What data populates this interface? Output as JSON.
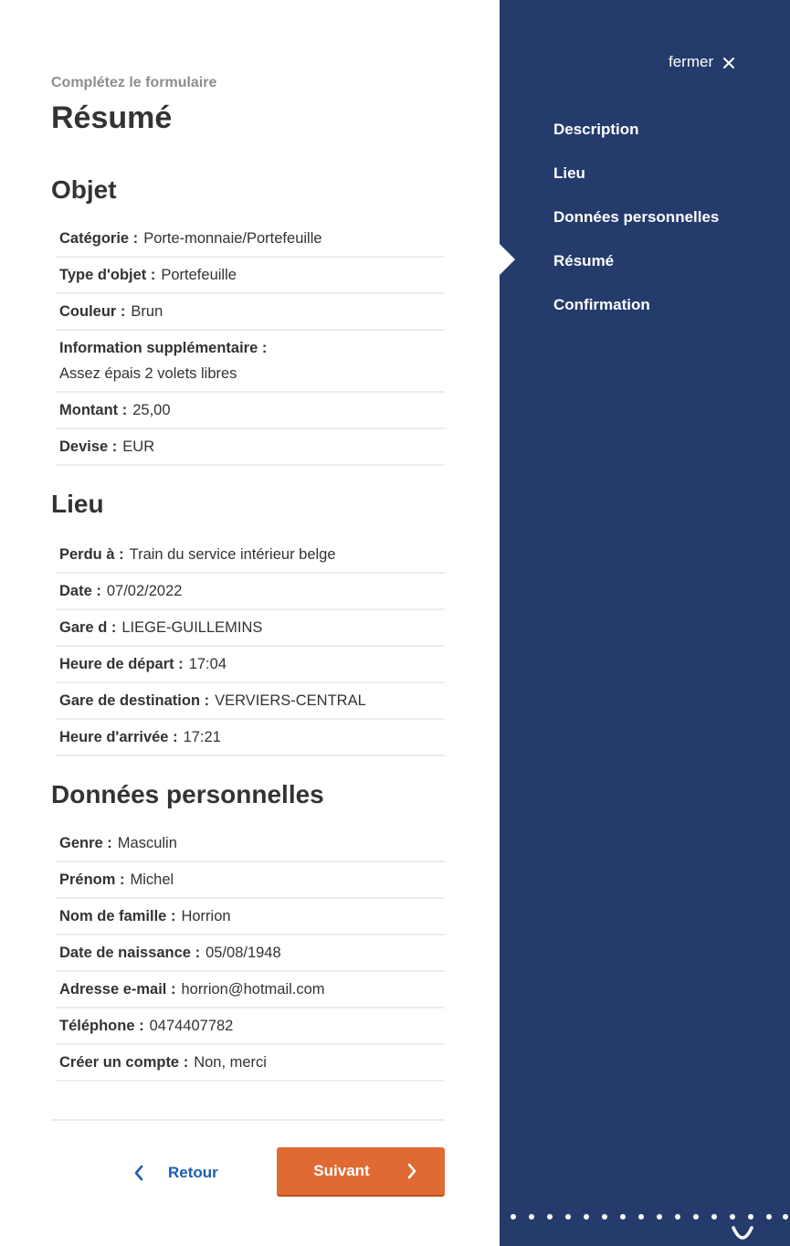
{
  "header": {
    "subtitle": "Complétez le formulaire",
    "title": "Résumé"
  },
  "sections": {
    "objet": {
      "title": "Objet",
      "rows": [
        {
          "label": "Catégorie :",
          "value": "Porte-monnaie/Portefeuille"
        },
        {
          "label": "Type d'objet :",
          "value": "Portefeuille"
        },
        {
          "label": "Couleur :",
          "value": "Brun"
        },
        {
          "label": "Information supplémentaire :",
          "value": "Assez épais 2 volets libres"
        },
        {
          "label": "Montant :",
          "value": "25,00"
        },
        {
          "label": "Devise :",
          "value": "EUR"
        }
      ]
    },
    "lieu": {
      "title": "Lieu",
      "rows": [
        {
          "label": "Perdu à :",
          "value": "Train du service intérieur belge"
        },
        {
          "label": "Date :",
          "value": "07/02/2022"
        },
        {
          "label": "Gare d :",
          "value": "LIEGE-GUILLEMINS"
        },
        {
          "label": "Heure de départ :",
          "value": "17:04"
        },
        {
          "label": "Gare de destination :",
          "value": "VERVIERS-CENTRAL"
        },
        {
          "label": "Heure d'arrivée :",
          "value": "17:21"
        }
      ]
    },
    "personnelles": {
      "title": "Données personnelles",
      "rows": [
        {
          "label": "Genre :",
          "value": "Masculin"
        },
        {
          "label": "Prénom :",
          "value": "Michel"
        },
        {
          "label": "Nom de famille :",
          "value": "Horrion"
        },
        {
          "label": "Date de naissance :",
          "value": "05/08/1948"
        },
        {
          "label": "Adresse e-mail :",
          "value": "horrion@hotmail.com"
        },
        {
          "label": "Téléphone :",
          "value": "0474407782"
        },
        {
          "label": "Créer un compte :",
          "value": "Non, merci"
        }
      ]
    }
  },
  "footer": {
    "back_label": "Retour",
    "next_label": "Suivant"
  },
  "sidebar": {
    "close_label": "fermer",
    "steps": [
      {
        "label": "Description"
      },
      {
        "label": "Lieu"
      },
      {
        "label": "Données personnelles"
      },
      {
        "label": "Résumé",
        "current": true
      },
      {
        "label": "Confirmation"
      }
    ]
  },
  "icons": {
    "close": "close-icon",
    "back": "chevron-left-icon",
    "next": "chevron-right-icon"
  },
  "colors": {
    "sidebar_bg": "#243b6c",
    "accent_button": "#e06a34",
    "link_blue": "#1f5db0",
    "muted_text": "#8d8d8d"
  }
}
